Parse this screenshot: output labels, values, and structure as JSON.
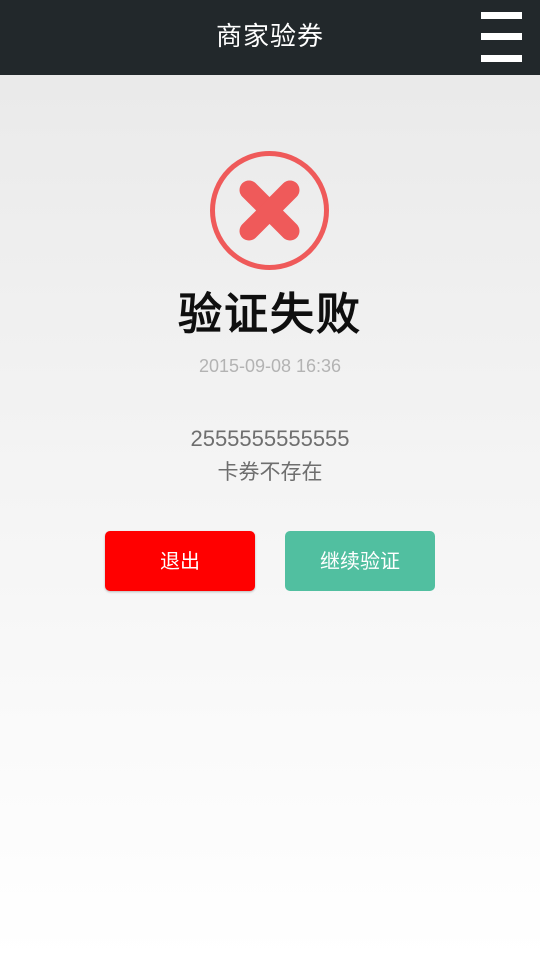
{
  "header": {
    "title": "商家验券",
    "menu_icon": "hamburger-menu-icon"
  },
  "result": {
    "icon": "error-x-circle-icon",
    "title": "验证失败",
    "timestamp": "2015-09-08 16:36",
    "coupon_code": "2555555555555",
    "message": "卡券不存在"
  },
  "actions": {
    "exit_label": "退出",
    "continue_label": "继续验证"
  },
  "colors": {
    "header_bg": "#22282b",
    "error_red": "#ef5a5a",
    "exit_button": "#ff0000",
    "continue_button": "#51bfa0"
  }
}
